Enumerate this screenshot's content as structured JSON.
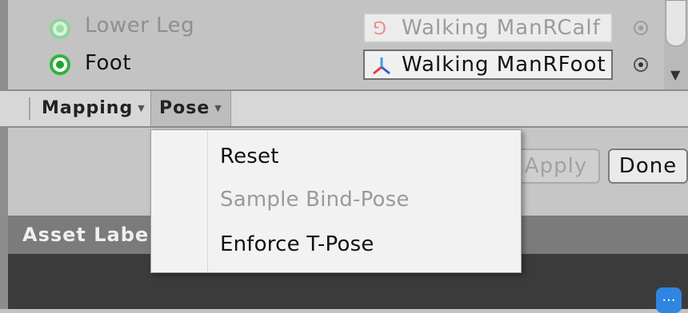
{
  "bones": [
    {
      "label": "Lower Leg",
      "object": "Walking ManRCalf",
      "state": "dim"
    },
    {
      "label": "Foot",
      "object": "Walking ManRFoot",
      "state": "on"
    }
  ],
  "toolbar": {
    "mapping_label": "Mapping",
    "pose_label": "Pose"
  },
  "actions": {
    "apply_label": "Apply",
    "done_label": "Done"
  },
  "asset_labels": {
    "title": "Asset Labe"
  },
  "more_button": {
    "label": "..."
  },
  "pose_menu": {
    "items": [
      {
        "label": "Reset",
        "enabled": true
      },
      {
        "label": "Sample Bind-Pose",
        "enabled": false
      },
      {
        "label": "Enforce T-Pose",
        "enabled": true
      }
    ]
  },
  "colors": {
    "radio_active": "#1ea52f",
    "panel_bg": "#c3c3c3",
    "dark_area": "#3b3b3b",
    "accent_blue": "#2e86e0"
  }
}
